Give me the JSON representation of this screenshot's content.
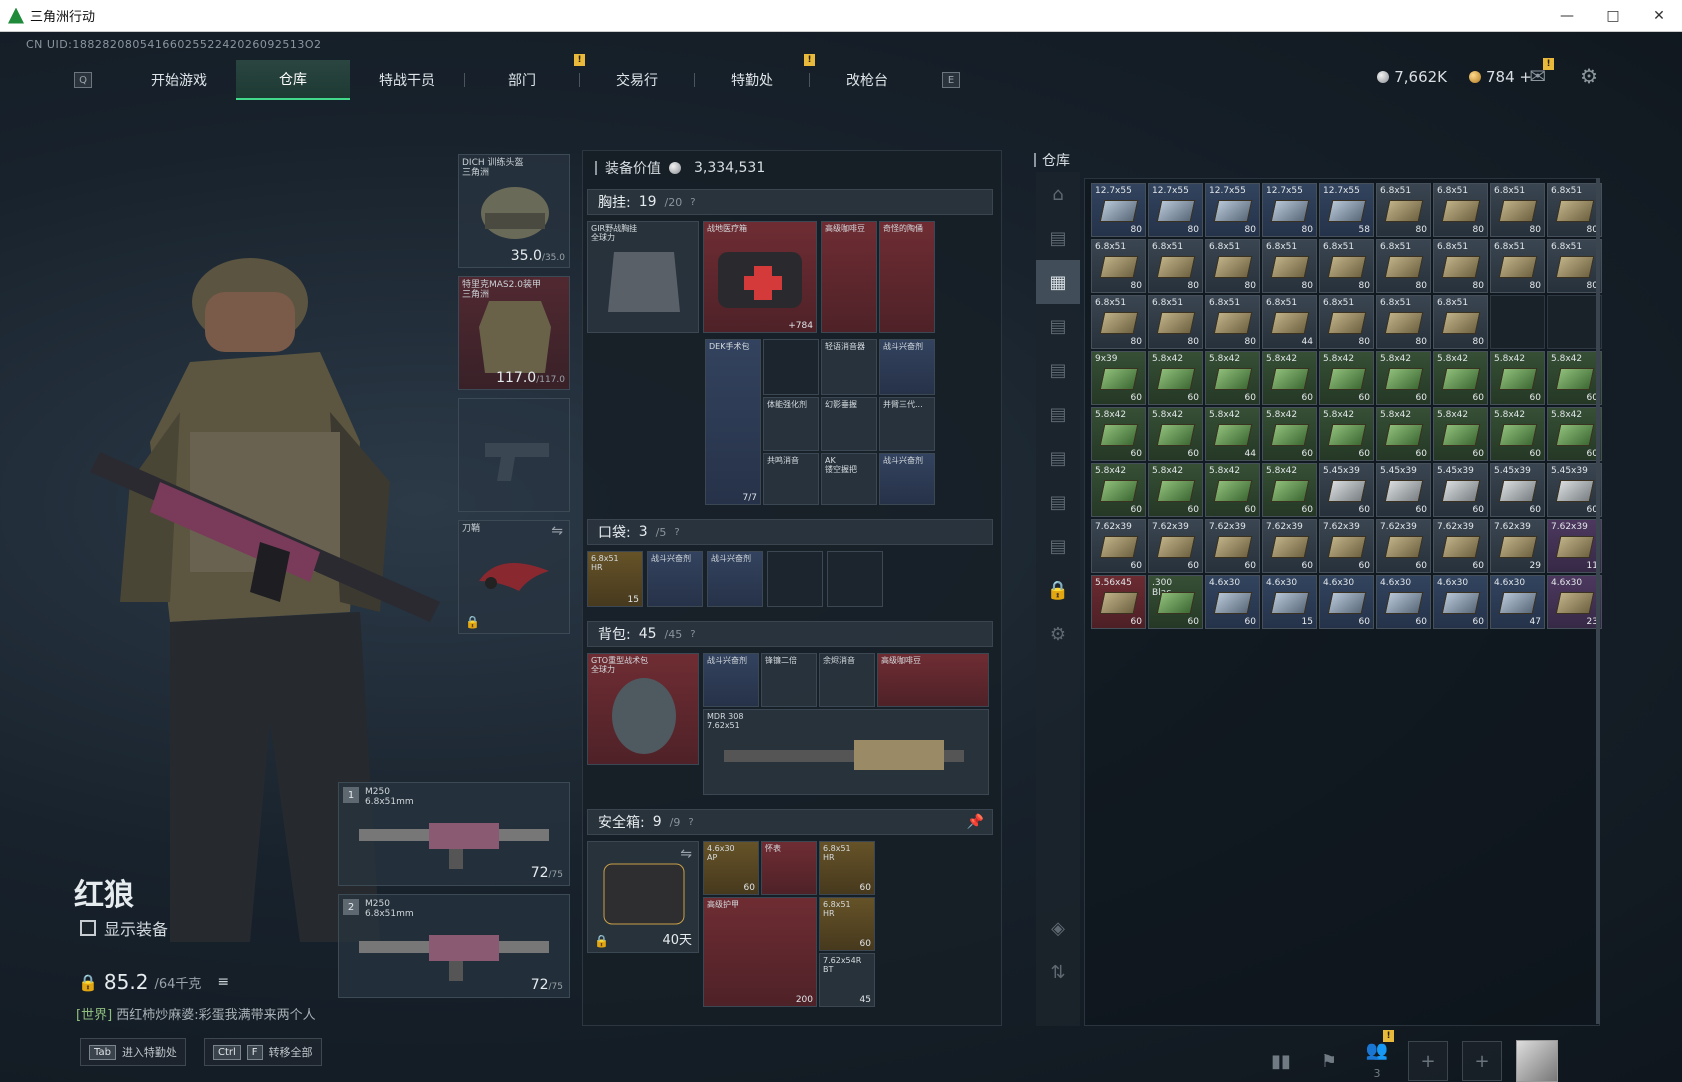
{
  "window": {
    "title": "三角洲行动",
    "min": "—",
    "max": "□",
    "close": "✕"
  },
  "uid": "CN UID:1882820805416602552242026092513O2",
  "nav": {
    "left_key": "Q",
    "right_key": "E",
    "tabs": [
      "开始游戏",
      "仓库",
      "特战干员",
      "部门",
      "交易行",
      "特勤处",
      "改枪台"
    ],
    "active": "仓库"
  },
  "currency": {
    "silver": "7,662K",
    "gold": "784",
    "plus": "+"
  },
  "operator": {
    "name": "红狼",
    "show_equipment": "显示装备",
    "weight": "85.2",
    "weight_max": "/64千克"
  },
  "world_chat": {
    "channel": "[世界]",
    "text": "西红柿炒麻婆:彩蛋我满带来两个人"
  },
  "hints": [
    {
      "key": "Tab",
      "label": "进入特勤处"
    },
    {
      "key": "Ctrl",
      "key2": "F",
      "label": "转移全部"
    }
  ],
  "bottom": {
    "friends": "3"
  },
  "equip": {
    "helmet": {
      "label": "DICH 训练头盔\n三角洲",
      "val": "35.0",
      "max": "/35.0"
    },
    "armor": {
      "label": "特里克MAS2.0装甲\n三角洲",
      "val": "117.0",
      "max": "/117.0"
    },
    "melee": {
      "label": "刀鞘"
    }
  },
  "weapons": [
    {
      "num": "1",
      "name": "M250\n6.8x51mm",
      "ammo": "72",
      "max": "/75"
    },
    {
      "num": "2",
      "name": "M250\n6.8x51mm",
      "ammo": "72",
      "max": "/75"
    }
  ],
  "gear": {
    "value_label": "装备价值",
    "value": "3,334,531",
    "chest": {
      "title": "胸挂:",
      "count": "19",
      "max": "/20",
      "q": "?"
    },
    "pocket": {
      "title": "口袋:",
      "count": "3",
      "max": "/5",
      "q": "?"
    },
    "backpack": {
      "title": "背包:",
      "count": "45",
      "max": "/45",
      "q": "?"
    },
    "safe": {
      "title": "安全箱:",
      "count": "9",
      "max": "/9",
      "q": "?",
      "days": "40天"
    },
    "chest_items": [
      {
        "t": "GIR野战胸挂\n全球力",
        "c": "",
        "n": ""
      },
      {
        "t": "战地医疗箱",
        "c": "red",
        "n": "+784"
      },
      {
        "t": "高级咖啡豆",
        "c": "red",
        "n": ""
      },
      {
        "t": "奇怪的陶俑",
        "c": "red",
        "n": ""
      },
      {
        "t": "DEK手术包",
        "c": "blue",
        "n": "7/7"
      },
      {
        "t": "轻语消音器",
        "c": "",
        "n": ""
      },
      {
        "t": "战斗兴奋剂",
        "c": "blue",
        "n": ""
      },
      {
        "t": "体能强化剂",
        "c": "",
        "n": ""
      },
      {
        "t": "幻影垂握",
        "c": "",
        "n": ""
      },
      {
        "t": "并臂三代...",
        "c": "",
        "n": ""
      },
      {
        "t": "共鸣消音",
        "c": "",
        "n": ""
      },
      {
        "t": "AK\n镂空握把",
        "c": "",
        "n": ""
      },
      {
        "t": "战斗兴奋剂",
        "c": "blue",
        "n": ""
      }
    ],
    "pocket_items": [
      {
        "t": "6.8x51\nHR",
        "n": "15"
      },
      {
        "t": "战斗兴奋剂",
        "n": ""
      },
      {
        "t": "战斗兴奋剂",
        "n": ""
      }
    ],
    "backpack_items": [
      {
        "t": "GTO重型战术包\n全球力",
        "c": "red"
      },
      {
        "t": "战斗兴奋剂",
        "c": "blue"
      },
      {
        "t": "锋镰二倍",
        "c": ""
      },
      {
        "t": "余烬消音",
        "c": ""
      },
      {
        "t": "高级咖啡豆",
        "c": "red"
      },
      {
        "t": "MDR 308\n7.62x51",
        "c": ""
      }
    ],
    "safe_items": [
      {
        "t": "4.6x30\nAP",
        "n": "60"
      },
      {
        "t": "怀表",
        "n": ""
      },
      {
        "t": "6.8x51\nHR",
        "n": "60"
      },
      {
        "t": "高级护甲",
        "n": "200"
      },
      {
        "t": "6.8x51\nHR",
        "n": "60"
      },
      {
        "t": "7.62x54R\nBT",
        "n": "45"
      }
    ]
  },
  "storage": {
    "title": "仓库",
    "cells": [
      {
        "t": "12.7x55",
        "n": "80",
        "c": "blue"
      },
      {
        "t": "12.7x55",
        "n": "80",
        "c": "blue"
      },
      {
        "t": "12.7x55",
        "n": "80",
        "c": "blue"
      },
      {
        "t": "12.7x55",
        "n": "80",
        "c": "blue"
      },
      {
        "t": "12.7x55",
        "n": "58",
        "c": "blue"
      },
      {
        "t": "6.8x51",
        "n": "80",
        "c": ""
      },
      {
        "t": "6.8x51",
        "n": "80",
        "c": ""
      },
      {
        "t": "6.8x51",
        "n": "80",
        "c": ""
      },
      {
        "t": "6.8x51",
        "n": "80",
        "c": ""
      },
      {
        "t": "6.8x51",
        "n": "80",
        "c": ""
      },
      {
        "t": "6.8x51",
        "n": "80",
        "c": ""
      },
      {
        "t": "6.8x51",
        "n": "80",
        "c": ""
      },
      {
        "t": "6.8x51",
        "n": "80",
        "c": ""
      },
      {
        "t": "6.8x51",
        "n": "80",
        "c": ""
      },
      {
        "t": "6.8x51",
        "n": "80",
        "c": ""
      },
      {
        "t": "6.8x51",
        "n": "80",
        "c": ""
      },
      {
        "t": "6.8x51",
        "n": "80",
        "c": ""
      },
      {
        "t": "6.8x51",
        "n": "80",
        "c": ""
      },
      {
        "t": "6.8x51",
        "n": "80",
        "c": ""
      },
      {
        "t": "6.8x51",
        "n": "80",
        "c": ""
      },
      {
        "t": "6.8x51",
        "n": "80",
        "c": ""
      },
      {
        "t": "6.8x51",
        "n": "44",
        "c": ""
      },
      {
        "t": "6.8x51",
        "n": "80",
        "c": ""
      },
      {
        "t": "6.8x51",
        "n": "80",
        "c": ""
      },
      {
        "t": "6.8x51",
        "n": "80",
        "c": ""
      },
      {
        "t": "",
        "n": "",
        "c": "empty"
      },
      {
        "t": "",
        "n": "",
        "c": "empty"
      },
      {
        "t": "9x39",
        "n": "60",
        "c": "green"
      },
      {
        "t": "5.8x42",
        "n": "60",
        "c": "green"
      },
      {
        "t": "5.8x42",
        "n": "60",
        "c": "green"
      },
      {
        "t": "5.8x42",
        "n": "60",
        "c": "green"
      },
      {
        "t": "5.8x42",
        "n": "60",
        "c": "green"
      },
      {
        "t": "5.8x42",
        "n": "60",
        "c": "green"
      },
      {
        "t": "5.8x42",
        "n": "60",
        "c": "green"
      },
      {
        "t": "5.8x42",
        "n": "60",
        "c": "green"
      },
      {
        "t": "5.8x42",
        "n": "60",
        "c": "green"
      },
      {
        "t": "5.8x42",
        "n": "60",
        "c": "green"
      },
      {
        "t": "5.8x42",
        "n": "60",
        "c": "green"
      },
      {
        "t": "5.8x42",
        "n": "44",
        "c": "green"
      },
      {
        "t": "5.8x42",
        "n": "60",
        "c": "green"
      },
      {
        "t": "5.8x42",
        "n": "60",
        "c": "green"
      },
      {
        "t": "5.8x42",
        "n": "60",
        "c": "green"
      },
      {
        "t": "5.8x42",
        "n": "60",
        "c": "green"
      },
      {
        "t": "5.8x42",
        "n": "60",
        "c": "green"
      },
      {
        "t": "5.8x42",
        "n": "60",
        "c": "green"
      },
      {
        "t": "5.8x42",
        "n": "60",
        "c": "green"
      },
      {
        "t": "5.8x42",
        "n": "60",
        "c": "green"
      },
      {
        "t": "5.8x42",
        "n": "60",
        "c": "green"
      },
      {
        "t": "5.8x42",
        "n": "60",
        "c": "green"
      },
      {
        "t": "5.45x39",
        "n": "60",
        "c": "gray"
      },
      {
        "t": "5.45x39",
        "n": "60",
        "c": "gray"
      },
      {
        "t": "5.45x39",
        "n": "60",
        "c": "gray"
      },
      {
        "t": "5.45x39",
        "n": "60",
        "c": "gray"
      },
      {
        "t": "5.45x39",
        "n": "60",
        "c": "gray"
      },
      {
        "t": "7.62x39",
        "n": "60",
        "c": ""
      },
      {
        "t": "7.62x39",
        "n": "60",
        "c": ""
      },
      {
        "t": "7.62x39",
        "n": "60",
        "c": ""
      },
      {
        "t": "7.62x39",
        "n": "60",
        "c": ""
      },
      {
        "t": "7.62x39",
        "n": "60",
        "c": ""
      },
      {
        "t": "7.62x39",
        "n": "60",
        "c": ""
      },
      {
        "t": "7.62x39",
        "n": "60",
        "c": ""
      },
      {
        "t": "7.62x39",
        "n": "29",
        "c": ""
      },
      {
        "t": "7.62x39",
        "n": "11",
        "c": "purple"
      },
      {
        "t": "5.56x45",
        "n": "60",
        "c": "red"
      },
      {
        "t": ".300 Blac...",
        "n": "60",
        "c": "green"
      },
      {
        "t": "4.6x30",
        "n": "60",
        "c": "blue"
      },
      {
        "t": "4.6x30",
        "n": "15",
        "c": "blue"
      },
      {
        "t": "4.6x30",
        "n": "60",
        "c": "blue"
      },
      {
        "t": "4.6x30",
        "n": "60",
        "c": "blue"
      },
      {
        "t": "4.6x30",
        "n": "60",
        "c": "blue"
      },
      {
        "t": "4.6x30",
        "n": "47",
        "c": "blue"
      },
      {
        "t": "4.6x30",
        "n": "23",
        "c": "purple"
      }
    ]
  }
}
